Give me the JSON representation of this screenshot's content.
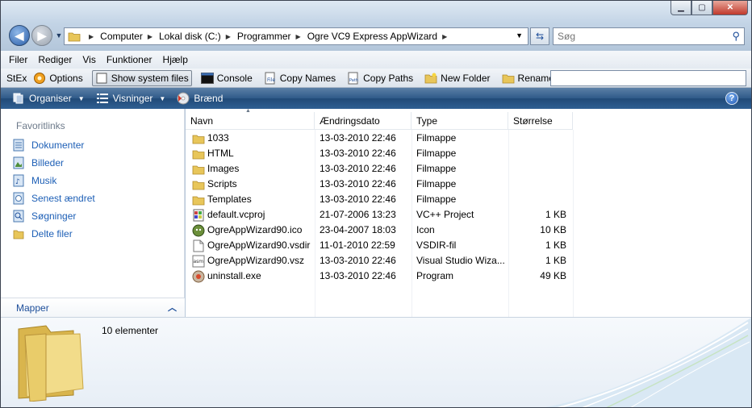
{
  "window": {
    "minimize_icon": "minimize-icon",
    "maximize_icon": "maximize-icon",
    "close_icon": "close-icon"
  },
  "address": {
    "crumbs": [
      "Computer",
      "Lokal disk (C:)",
      "Programmer",
      "Ogre VC9 Express AppWizard"
    ]
  },
  "search": {
    "placeholder": "Søg"
  },
  "menu": [
    "Filer",
    "Rediger",
    "Vis",
    "Funktioner",
    "Hjælp"
  ],
  "stex": {
    "label": "StEx",
    "options": "Options",
    "show_system_files": "Show system files",
    "console": "Console",
    "copy_names": "Copy Names",
    "copy_paths": "Copy Paths",
    "new_folder": "New Folder",
    "rename": "Rename",
    "rename_value": ""
  },
  "commands": {
    "organise": "Organiser",
    "views": "Visninger",
    "burn": "Brænd"
  },
  "navpane": {
    "header": "Favoritlinks",
    "links": [
      "Dokumenter",
      "Billeder",
      "Musik",
      "Senest ændret",
      "Søgninger",
      "Delte filer"
    ],
    "folders_label": "Mapper"
  },
  "columns": [
    "Navn",
    "Ændringsdato",
    "Type",
    "Størrelse"
  ],
  "files": [
    {
      "name": "1033",
      "date": "13-03-2010 22:46",
      "type": "Filmappe",
      "size": "",
      "icon": "folder-icon"
    },
    {
      "name": "HTML",
      "date": "13-03-2010 22:46",
      "type": "Filmappe",
      "size": "",
      "icon": "folder-icon"
    },
    {
      "name": "Images",
      "date": "13-03-2010 22:46",
      "type": "Filmappe",
      "size": "",
      "icon": "folder-icon"
    },
    {
      "name": "Scripts",
      "date": "13-03-2010 22:46",
      "type": "Filmappe",
      "size": "",
      "icon": "folder-icon"
    },
    {
      "name": "Templates",
      "date": "13-03-2010 22:46",
      "type": "Filmappe",
      "size": "",
      "icon": "folder-icon"
    },
    {
      "name": "default.vcproj",
      "date": "21-07-2006 13:23",
      "type": "VC++ Project",
      "size": "1 KB",
      "icon": "vcproj-icon"
    },
    {
      "name": "OgreAppWizard90.ico",
      "date": "23-04-2007 18:03",
      "type": "Icon",
      "size": "10 KB",
      "icon": "ogre-icon"
    },
    {
      "name": "OgreAppWizard90.vsdir",
      "date": "11-01-2010 22:59",
      "type": "VSDIR-fil",
      "size": "1 KB",
      "icon": "document-icon"
    },
    {
      "name": "OgreAppWizard90.vsz",
      "date": "13-03-2010 22:46",
      "type": "Visual Studio Wiza...",
      "size": "1 KB",
      "icon": "asm-file-icon"
    },
    {
      "name": "uninstall.exe",
      "date": "13-03-2010 22:46",
      "type": "Program",
      "size": "49 KB",
      "icon": "uninstall-icon"
    }
  ],
  "details": {
    "count": "10 elementer"
  }
}
